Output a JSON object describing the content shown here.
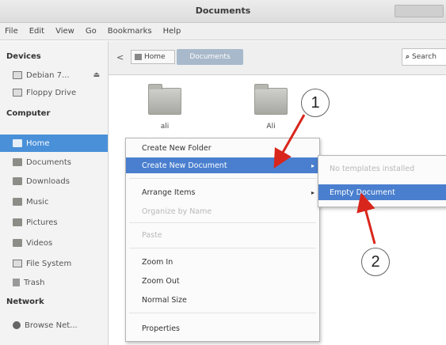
{
  "window": {
    "title": "Documents"
  },
  "menubar": [
    "File",
    "Edit",
    "View",
    "Go",
    "Bookmarks",
    "Help"
  ],
  "sidebar": {
    "devices_label": "Devices",
    "devices": [
      {
        "label": "Debian 7...",
        "icon": "drive-icon"
      },
      {
        "label": "Floppy Drive",
        "icon": "floppy-icon"
      }
    ],
    "computer_label": "Computer",
    "computer": [
      {
        "label": "Home",
        "icon": "home-folder-icon",
        "selected": true
      },
      {
        "label": "Documents",
        "icon": "folder-icon"
      },
      {
        "label": "Downloads",
        "icon": "folder-icon"
      },
      {
        "label": "Music",
        "icon": "folder-icon"
      },
      {
        "label": "Pictures",
        "icon": "folder-icon"
      },
      {
        "label": "Videos",
        "icon": "folder-icon"
      },
      {
        "label": "File System",
        "icon": "drive-icon"
      },
      {
        "label": "Trash",
        "icon": "trash-icon"
      }
    ],
    "network_label": "Network",
    "network": [
      {
        "label": "Browse Net...",
        "icon": "network-icon"
      }
    ]
  },
  "toolbar": {
    "back_glyph": "<",
    "breadcrumb_home": "Home",
    "breadcrumb_current": "Documents",
    "search_label": "Search"
  },
  "files": [
    {
      "name": "ali"
    },
    {
      "name": "Ali"
    }
  ],
  "context_menu": {
    "items": [
      {
        "label": "Create New Folder",
        "state": "normal"
      },
      {
        "label": "Create New Document",
        "state": "highlighted",
        "submenu": true
      },
      {
        "label": "Arrange Items",
        "state": "normal",
        "submenu": true
      },
      {
        "label": "Organize by Name",
        "state": "disabled"
      },
      {
        "label": "Paste",
        "state": "disabled"
      },
      {
        "label": "Zoom In",
        "state": "normal"
      },
      {
        "label": "Zoom Out",
        "state": "normal"
      },
      {
        "label": "Normal Size",
        "state": "normal"
      },
      {
        "label": "Properties",
        "state": "normal"
      }
    ]
  },
  "submenu": {
    "items": [
      {
        "label": "No templates installed",
        "state": "disabled"
      },
      {
        "label": "Empty Document",
        "state": "highlighted"
      }
    ]
  },
  "annotations": [
    {
      "label": "1",
      "color": "#d9261c"
    },
    {
      "label": "2",
      "color": "#d9261c"
    }
  ]
}
